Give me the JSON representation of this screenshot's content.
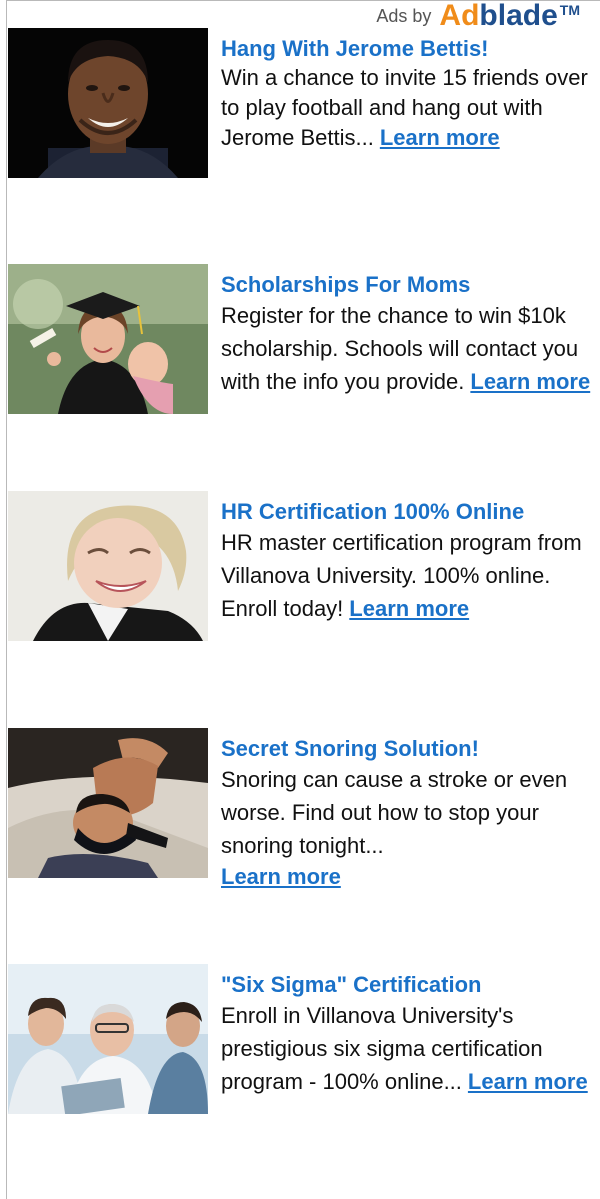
{
  "header": {
    "ads_by_label": "Ads by",
    "logo_ad": "Ad",
    "logo_blade": "blade",
    "logo_tm": "TM"
  },
  "ads": [
    {
      "title": "Hang With Jerome Bettis!",
      "description": "Win a chance to invite 15 friends over to play football and hang out with Jerome Bettis...",
      "link": "Learn more",
      "image": "man-portrait-image"
    },
    {
      "title": "Scholarships For Moms",
      "description": "Register for the chance to win $10k scholarship. Schools will contact you with the info you provide.",
      "link": "Learn more",
      "image": "graduate-mom-with-baby-image"
    },
    {
      "title": "HR Certification 100% Online",
      "description": "HR master certification program from Villanova University. 100% online. Enroll today!",
      "link": "Learn more",
      "image": "smiling-woman-image"
    },
    {
      "title": "Secret Snoring Solution!",
      "description": "Snoring can cause a stroke or even worse. Find out how to stop your snoring tonight...",
      "link": "Learn more",
      "image": "man-with-chin-strap-image"
    },
    {
      "title": "\"Six Sigma\" Certification",
      "description": "Enroll in Villanova University's prestigious six sigma certification program - 100% online...",
      "link": "Learn more",
      "image": "doctors-group-image"
    }
  ],
  "colors": {
    "title_blue": "#1a71c8",
    "logo_orange": "#f08c1a",
    "logo_navy": "#1f4f8d"
  }
}
